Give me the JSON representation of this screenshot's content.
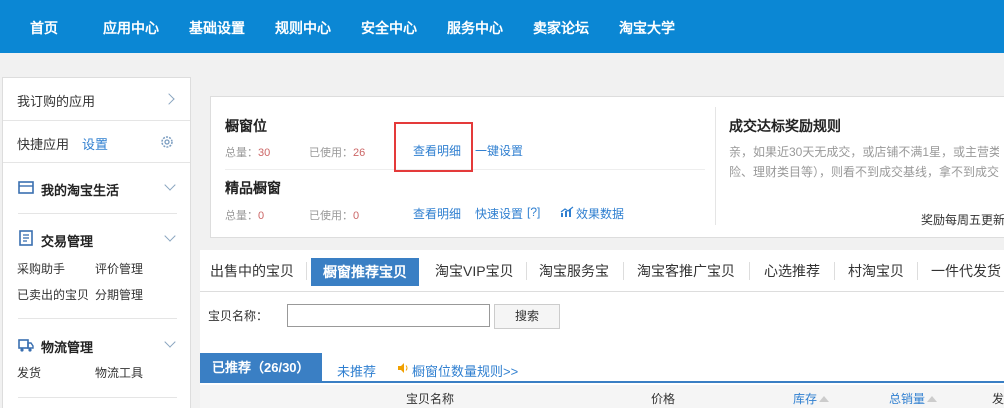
{
  "topnav": {
    "items": [
      "首页",
      "应用中心",
      "基础设置",
      "规则中心",
      "安全中心",
      "服务中心",
      "卖家论坛",
      "淘宝大学"
    ]
  },
  "sidebar": {
    "subscribed": "我订购的应用",
    "quick_apps": "快捷应用",
    "settings_link": "设置",
    "sections": [
      {
        "title": "我的淘宝生活",
        "icon": "wallet-icon",
        "links": []
      },
      {
        "title": "交易管理",
        "icon": "document-icon",
        "links": [
          "采购助手",
          "评价管理",
          "已卖出的宝贝",
          "分期管理"
        ]
      },
      {
        "title": "物流管理",
        "icon": "truck-icon",
        "links": [
          "发货",
          "物流工具"
        ]
      }
    ]
  },
  "window_info": {
    "title": "橱窗位",
    "total_label": "总量：",
    "total_value": "30",
    "used_label": "已使用：",
    "used_value": "26",
    "view_detail": "查看明细",
    "one_click": "一键设置"
  },
  "boutique": {
    "title": "精品橱窗",
    "total_label": "总量：",
    "total_value": "0",
    "used_label": "已使用：",
    "used_value": "0",
    "view_detail": "查看明细",
    "quick_set": "快速设置",
    "help": "[?]",
    "effect_data": "效果数据"
  },
  "reward_rules": {
    "title": "成交达标奖励规则",
    "line1": "亲，如果近30天无成交，或店铺不满1星，或主营类",
    "line2": "险、理财类目等），则看不到成交基线，拿不到成交",
    "update": "奖励每周五更新"
  },
  "tabs": [
    "出售中的宝贝",
    "橱窗推荐宝贝",
    "淘宝VIP宝贝",
    "淘宝服务宝",
    "淘宝客推广宝贝",
    "心选推荐",
    "村淘宝贝",
    "一件代发货"
  ],
  "search": {
    "label": "宝贝名称：",
    "value": "",
    "button": "搜索"
  },
  "subtabs": {
    "recommended": "已推荐（26/30）",
    "not_recommended": "未推荐",
    "rules_link": "橱窗位数量规则>>"
  },
  "table": {
    "headers": [
      "宝贝名称",
      "价格",
      "库存",
      "总销量",
      "发"
    ]
  }
}
